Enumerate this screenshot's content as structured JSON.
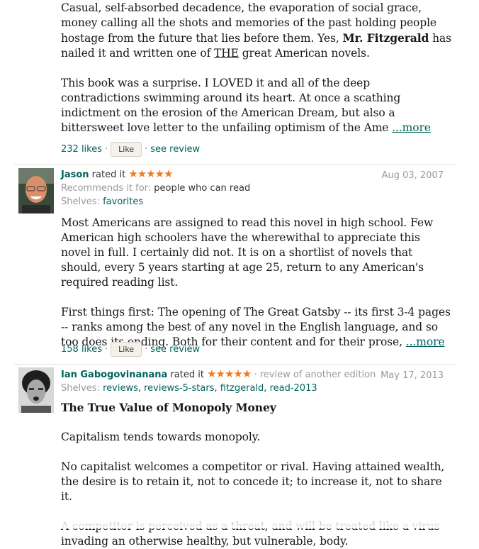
{
  "review1": {
    "p1": "Casual, self-absorbed decadence, the evaporation of social grace, money calling all the shots and memories of the past holding people hostage from the future that lies before them. Yes, ",
    "p1_bold": "Mr. Fitzgerald",
    "p1_mid": " has nailed it and written one of ",
    "p1_underline": "THE",
    "p1_end": " great American novels.",
    "p2": "This book was a surprise. I LOVED it and all of the deep contradictions swimming around its heart. At once a scathing indictment on the erosion of the American Dream, but also a bittersweet love letter to the unfailing optimism of the Ame ",
    "more": "...more",
    "likes": "232 likes",
    "like_label": "Like",
    "see_review": "see review"
  },
  "review2": {
    "user": "Jason",
    "rated": " rated it ",
    "stars": "★★★★★",
    "date": "Aug 03, 2007",
    "recommends_label": "Recommends it for: ",
    "recommends_value": "people who can read",
    "shelves_label": "Shelves: ",
    "shelves": "favorites",
    "p1": "Most Americans are assigned to read this novel in high school. Few American high schoolers have the wherewithal to appreciate this novel in full. I certainly did not. It is on a shortlist of novels that should, every 5 years starting at age 25, return to any American's required reading list.",
    "p2": "First things first: The opening of The Great Gatsby -- its first 3-4 pages -- ranks among the best of any novel in the English language, and so too does its ending. Both for their content and for their prose, ",
    "more": "...more",
    "likes": "158 likes",
    "like_label": "Like",
    "see_review": "see review"
  },
  "review3": {
    "user": "Ian Gabogovinanana",
    "rated": " rated it ",
    "stars": "★★★★★",
    "sep": " · ",
    "edition": "review of another edition",
    "date": "May 17, 2013",
    "shelves_label": "Shelves: ",
    "shelf_items": [
      "reviews",
      "reviews-5-stars",
      "fitzgerald",
      "read-2013"
    ],
    "title": "The True Value of Monopoly Money",
    "p1": "Capitalism tends towards monopoly.",
    "p2": "No capitalist welcomes a competitor or rival. Having attained wealth, the desire is to retain it, not to concede it; to increase it, not to share it.",
    "p3": "A competitor is perceived as a threat, and will be treated like a virus invading an otherwise healthy, but vulnerable, body."
  },
  "colors": {
    "link": "#00635d",
    "star": "#f37a1f",
    "muted": "#999999"
  }
}
